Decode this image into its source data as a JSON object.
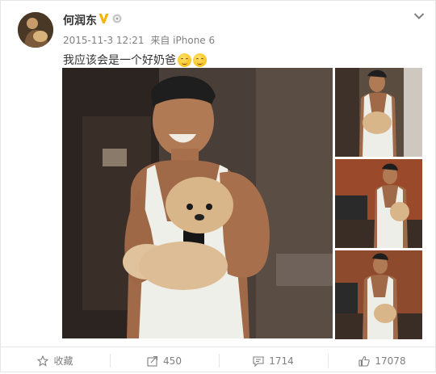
{
  "post": {
    "author": "何润东",
    "timestamp": "2015-11-3 12:21",
    "source_prefix": "来自",
    "source": "iPhone 6",
    "text": "我应该会是一个好奶爸"
  },
  "icons": {
    "verified": "verified-v-icon",
    "level": "level-icon",
    "more": "chevron-down-icon",
    "favorite": "star-icon",
    "repost": "repost-icon",
    "comment": "comment-icon",
    "like": "thumbs-up-icon"
  },
  "actions": {
    "favorite_label": "收藏",
    "repost_count": "450",
    "comment_count": "1714",
    "like_count": "17078"
  },
  "colors": {
    "verified": "#f7b500",
    "meta_text": "#808080",
    "border": "#e6e6e6"
  }
}
